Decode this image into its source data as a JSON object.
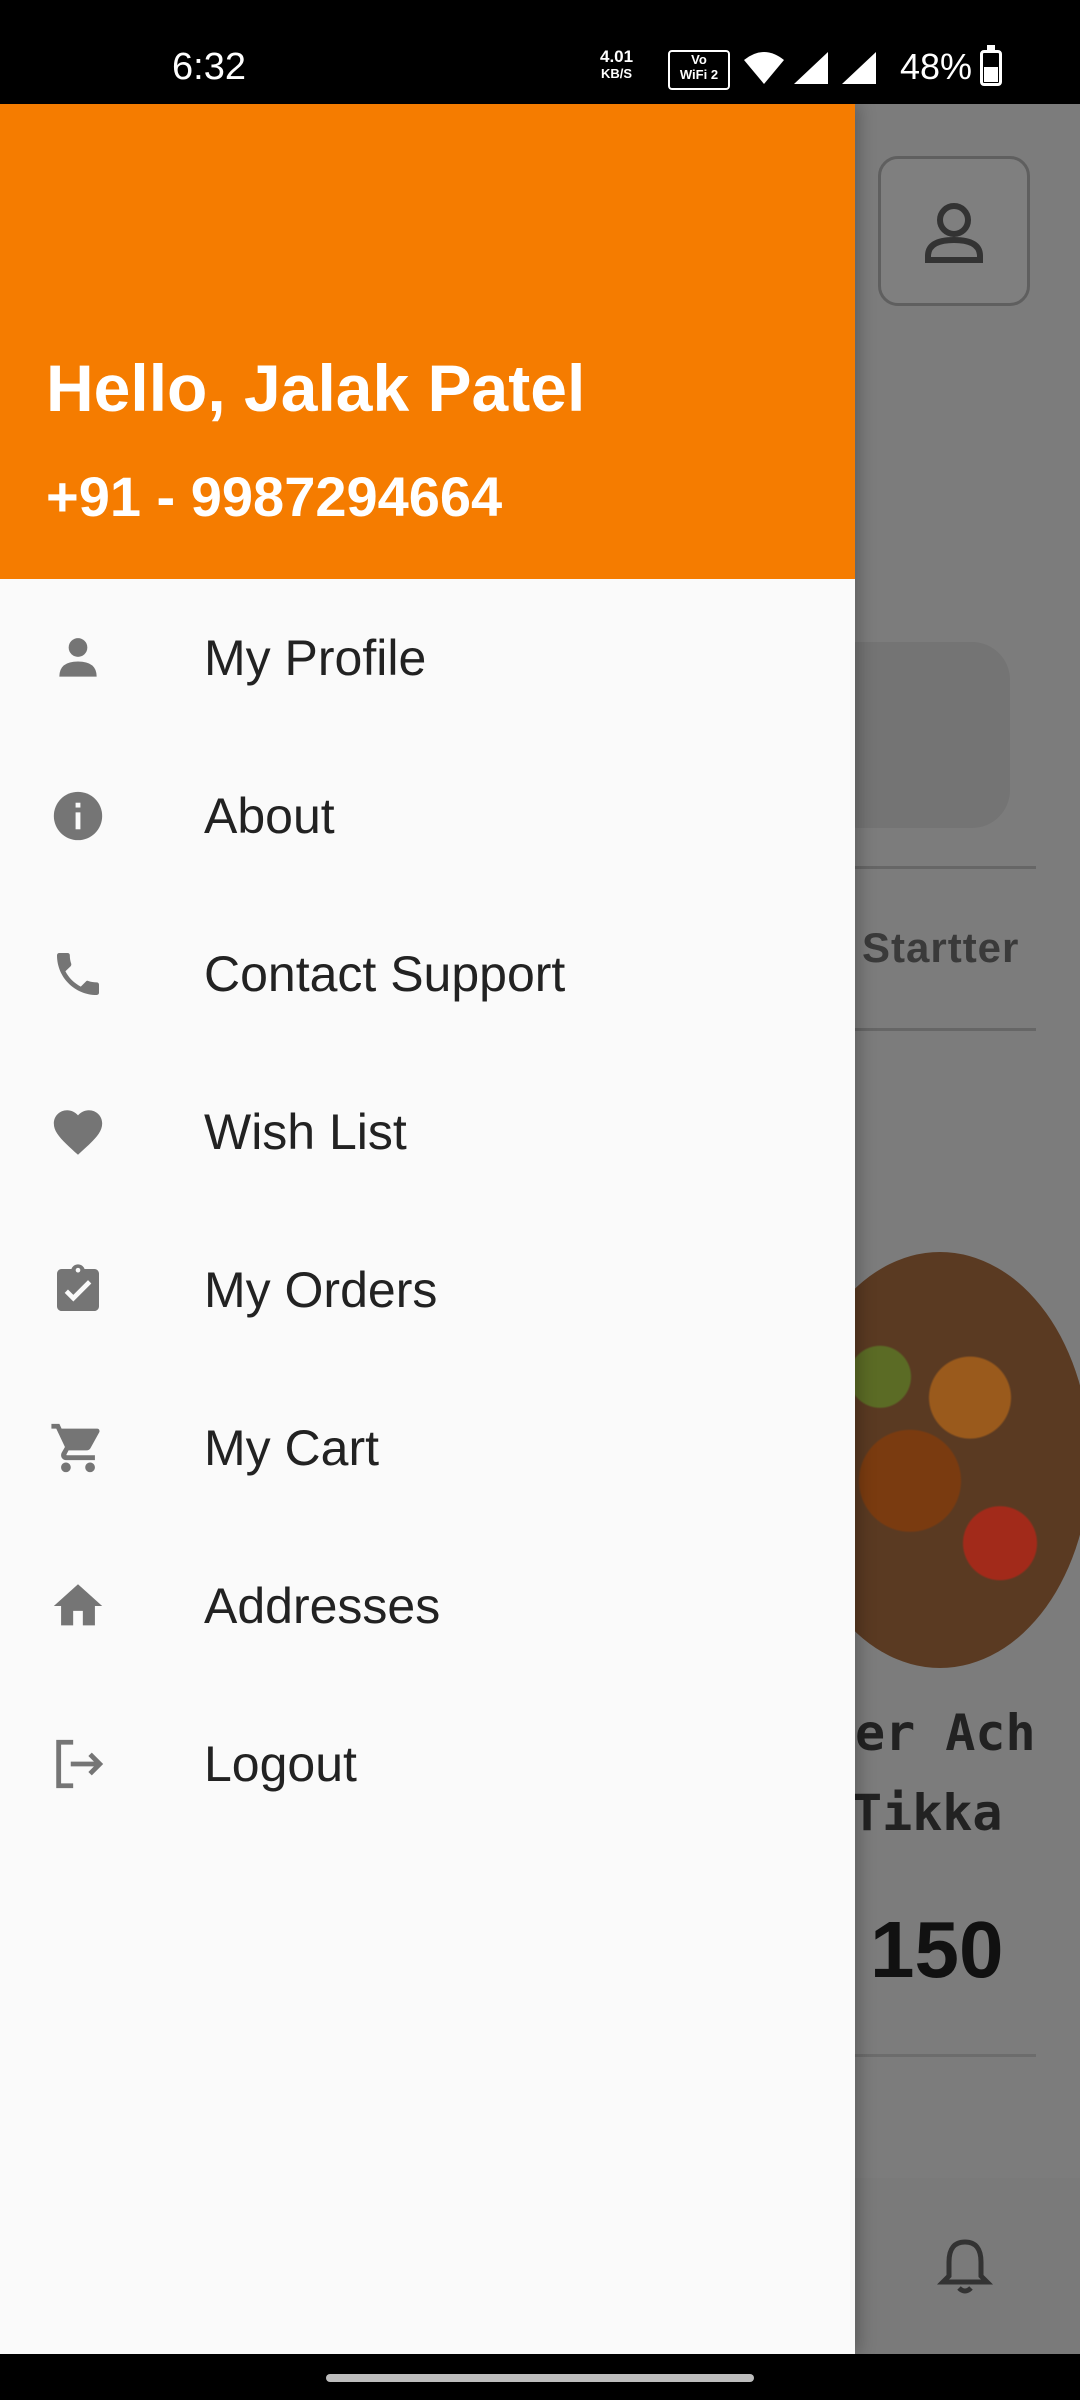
{
  "status_bar": {
    "time": "6:32",
    "net_speed_value": "4.01",
    "net_speed_unit": "KB/S",
    "volte_text": "Vo",
    "wifi_text": "WiFi 2",
    "battery": "48%"
  },
  "background": {
    "category_tab": "Startter",
    "item_name_line1": "er Ach",
    "item_name_line2": "Tikka",
    "item_price": "150"
  },
  "drawer": {
    "greeting": "Hello, Jalak Patel",
    "phone": "+91 - 9987294664",
    "items": [
      {
        "label": "My Profile",
        "icon": "person-icon"
      },
      {
        "label": "About",
        "icon": "info-icon"
      },
      {
        "label": "Contact Support",
        "icon": "phone-icon"
      },
      {
        "label": "Wish List",
        "icon": "heart-icon"
      },
      {
        "label": "My Orders",
        "icon": "clipboard-check-icon"
      },
      {
        "label": "My Cart",
        "icon": "cart-icon"
      },
      {
        "label": "Addresses",
        "icon": "home-icon"
      },
      {
        "label": "Logout",
        "icon": "logout-icon"
      }
    ]
  },
  "colors": {
    "header": "#f57c00",
    "drawer_bg": "#fafafa",
    "icon": "#757575"
  }
}
